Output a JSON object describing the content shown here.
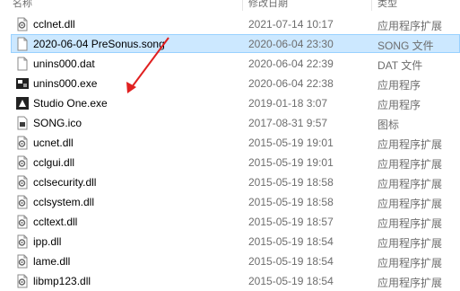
{
  "header": {
    "name": "名称",
    "date": "修改日期",
    "type": "类型"
  },
  "files": [
    {
      "name": "cclnet.dll",
      "date": "2021-07-14 10:17",
      "type": "应用程序扩展",
      "icon": "dll-gear-icon"
    },
    {
      "name": "2020-06-04 PreSonus.song",
      "date": "2020-06-04 23:30",
      "type": "SONG 文件",
      "icon": "document-icon",
      "selected": true
    },
    {
      "name": "unins000.dat",
      "date": "2020-06-04 22:39",
      "type": "DAT 文件",
      "icon": "document-icon"
    },
    {
      "name": "unins000.exe",
      "date": "2020-06-04 22:38",
      "type": "应用程序",
      "icon": "installer-exe-icon"
    },
    {
      "name": "Studio One.exe",
      "date": "2019-01-18 3:07",
      "type": "应用程序",
      "icon": "studio-one-exe-icon"
    },
    {
      "name": "SONG.ico",
      "date": "2017-08-31 9:57",
      "type": "图标",
      "icon": "ico-file-icon"
    },
    {
      "name": "ucnet.dll",
      "date": "2015-05-19 19:01",
      "type": "应用程序扩展",
      "icon": "dll-gear-icon"
    },
    {
      "name": "cclgui.dll",
      "date": "2015-05-19 19:01",
      "type": "应用程序扩展",
      "icon": "dll-gear-icon"
    },
    {
      "name": "cclsecurity.dll",
      "date": "2015-05-19 18:58",
      "type": "应用程序扩展",
      "icon": "dll-gear-icon"
    },
    {
      "name": "cclsystem.dll",
      "date": "2015-05-19 18:58",
      "type": "应用程序扩展",
      "icon": "dll-gear-icon"
    },
    {
      "name": "ccltext.dll",
      "date": "2015-05-19 18:57",
      "type": "应用程序扩展",
      "icon": "dll-gear-icon"
    },
    {
      "name": "ipp.dll",
      "date": "2015-05-19 18:54",
      "type": "应用程序扩展",
      "icon": "dll-gear-icon"
    },
    {
      "name": "lame.dll",
      "date": "2015-05-19 18:54",
      "type": "应用程序扩展",
      "icon": "dll-gear-icon"
    },
    {
      "name": "libmp123.dll",
      "date": "2015-05-19 18:54",
      "type": "应用程序扩展",
      "icon": "dll-gear-icon"
    }
  ],
  "colors": {
    "selection": "#cce8ff",
    "selection_border": "#99d1ff",
    "arrow": "#e02020",
    "secondary_text": "#6d6d6d"
  }
}
